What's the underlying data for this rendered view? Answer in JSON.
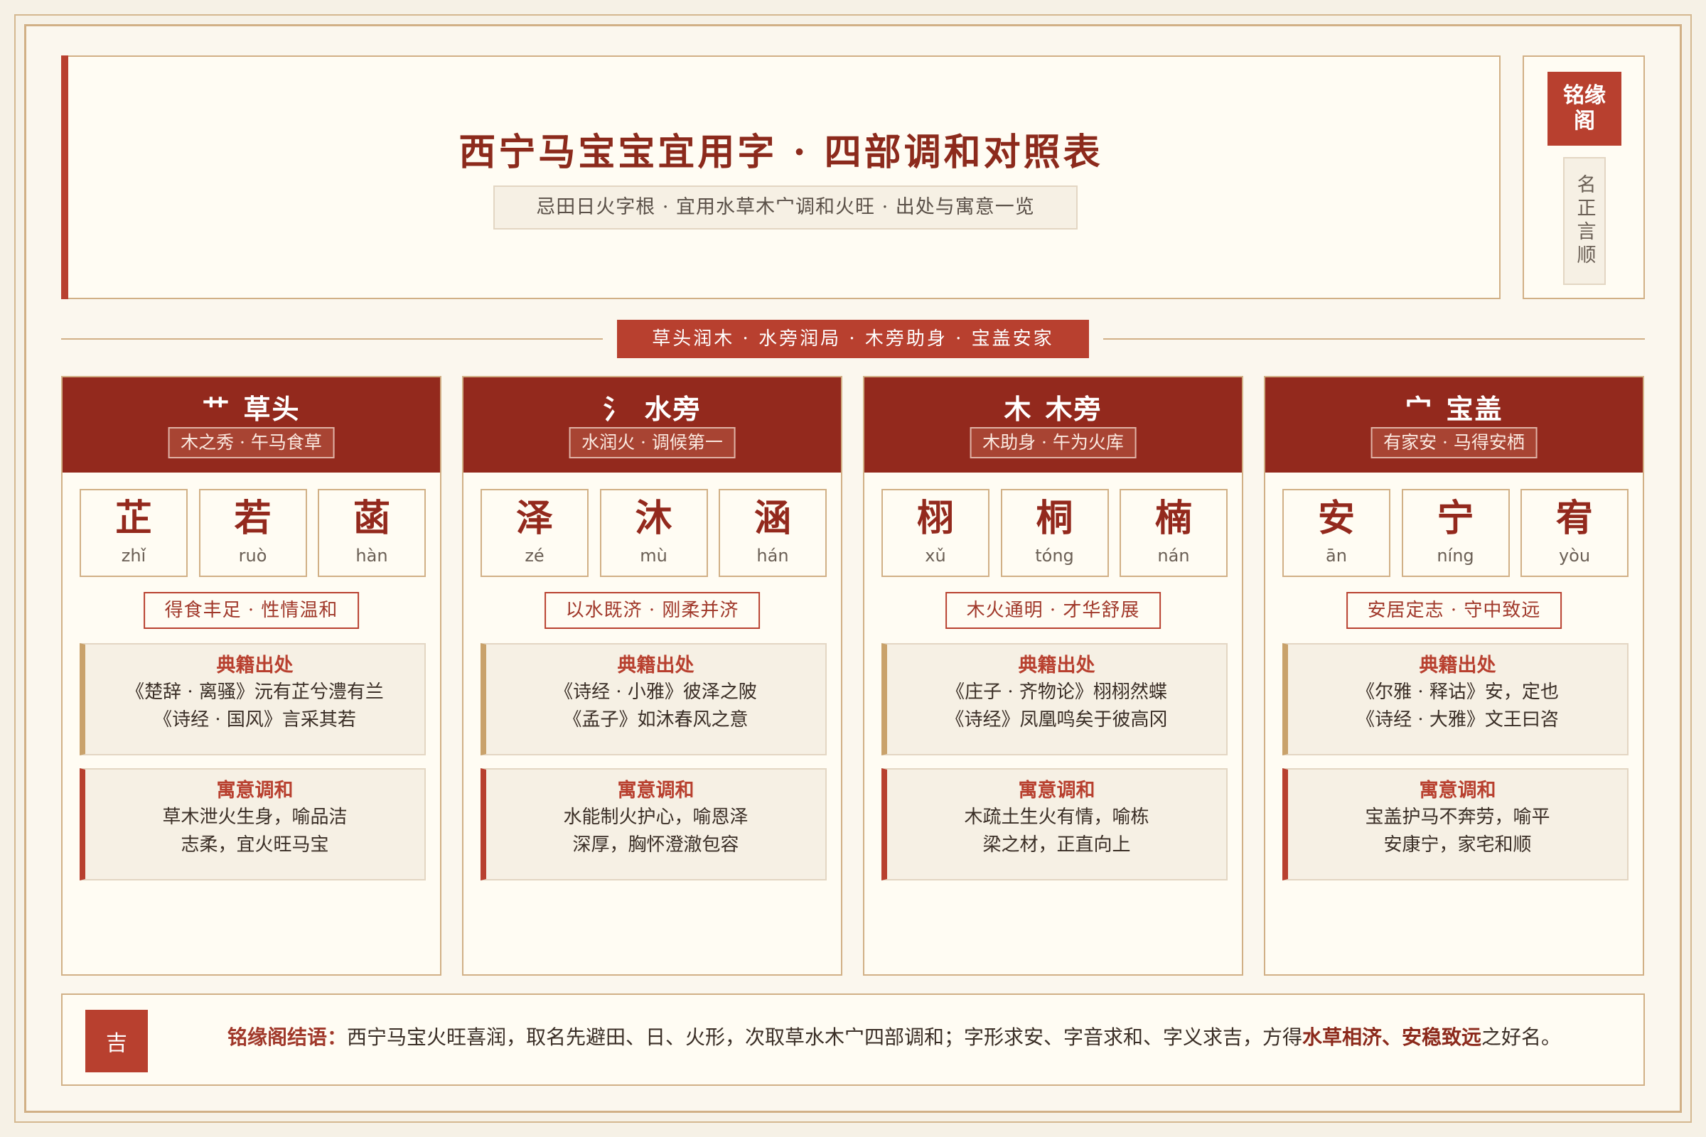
{
  "header": {
    "title": "西宁马宝宝宜用字 · 四部调和对照表",
    "subtitle": "忌田日火字根 · 宜用水草木宀调和火旺 · 出处与寓意一览",
    "seal": "铭缘阁",
    "motto": "名正言顺"
  },
  "divider": "草头润木 · 水旁润局 · 木旁助身 · 宝盖安家",
  "cards": [
    {
      "radical": "艹",
      "name": "草头",
      "sub": "木之秀 · 午马食草",
      "chars": [
        {
          "zi": "芷",
          "py": "zhǐ"
        },
        {
          "zi": "若",
          "py": "ruò"
        },
        {
          "zi": "菡",
          "py": "hàn"
        }
      ],
      "tag": "得食丰足 · 性情温和",
      "source_title": "典籍出处",
      "source_lines": [
        "《楚辞 · 离骚》沅有芷兮澧有兰",
        "《诗经 · 国风》言采其若"
      ],
      "meaning_title": "寓意调和",
      "meaning_lines": [
        "草木泄火生身，喻品洁",
        "志柔，宜火旺马宝"
      ]
    },
    {
      "radical": "氵",
      "name": "水旁",
      "sub": "水润火 · 调候第一",
      "chars": [
        {
          "zi": "泽",
          "py": "zé"
        },
        {
          "zi": "沐",
          "py": "mù"
        },
        {
          "zi": "涵",
          "py": "hán"
        }
      ],
      "tag": "以水既济 · 刚柔并济",
      "source_title": "典籍出处",
      "source_lines": [
        "《诗经 · 小雅》彼泽之陂",
        "《孟子》如沐春风之意"
      ],
      "meaning_title": "寓意调和",
      "meaning_lines": [
        "水能制火护心，喻恩泽",
        "深厚，胸怀澄澈包容"
      ]
    },
    {
      "radical": "木",
      "name": "木旁",
      "sub": "木助身 · 午为火库",
      "chars": [
        {
          "zi": "栩",
          "py": "xǔ"
        },
        {
          "zi": "桐",
          "py": "tóng"
        },
        {
          "zi": "楠",
          "py": "nán"
        }
      ],
      "tag": "木火通明 · 才华舒展",
      "source_title": "典籍出处",
      "source_lines": [
        "《庄子 · 齐物论》栩栩然蝶",
        "《诗经》凤凰鸣矣于彼高冈"
      ],
      "meaning_title": "寓意调和",
      "meaning_lines": [
        "木疏土生火有情，喻栋",
        "梁之材，正直向上"
      ]
    },
    {
      "radical": "宀",
      "name": "宝盖",
      "sub": "有家安 · 马得安栖",
      "chars": [
        {
          "zi": "安",
          "py": "ān"
        },
        {
          "zi": "宁",
          "py": "níng"
        },
        {
          "zi": "宥",
          "py": "yòu"
        }
      ],
      "tag": "安居定志 · 守中致远",
      "source_title": "典籍出处",
      "source_lines": [
        "《尔雅 · 释诂》安，定也",
        "《诗经 · 大雅》文王曰咨"
      ],
      "meaning_title": "寓意调和",
      "meaning_lines": [
        "宝盖护马不奔劳，喻平",
        "安康宁，家宅和顺"
      ]
    }
  ],
  "footer": {
    "seal": "吉",
    "lead": "铭缘阁结语：",
    "text": "西宁马宝火旺喜润，取名先避田、日、火形，次取草水木宀四部调和；字形求安、字音求和、字义求吉，方得",
    "highlight": "水草相济、安稳致远",
    "tail": "之好名。"
  },
  "colors": {
    "accent": "#b8402f",
    "header_red": "#93291d",
    "gold": "#d1b086",
    "paper": "#fffcf3"
  }
}
